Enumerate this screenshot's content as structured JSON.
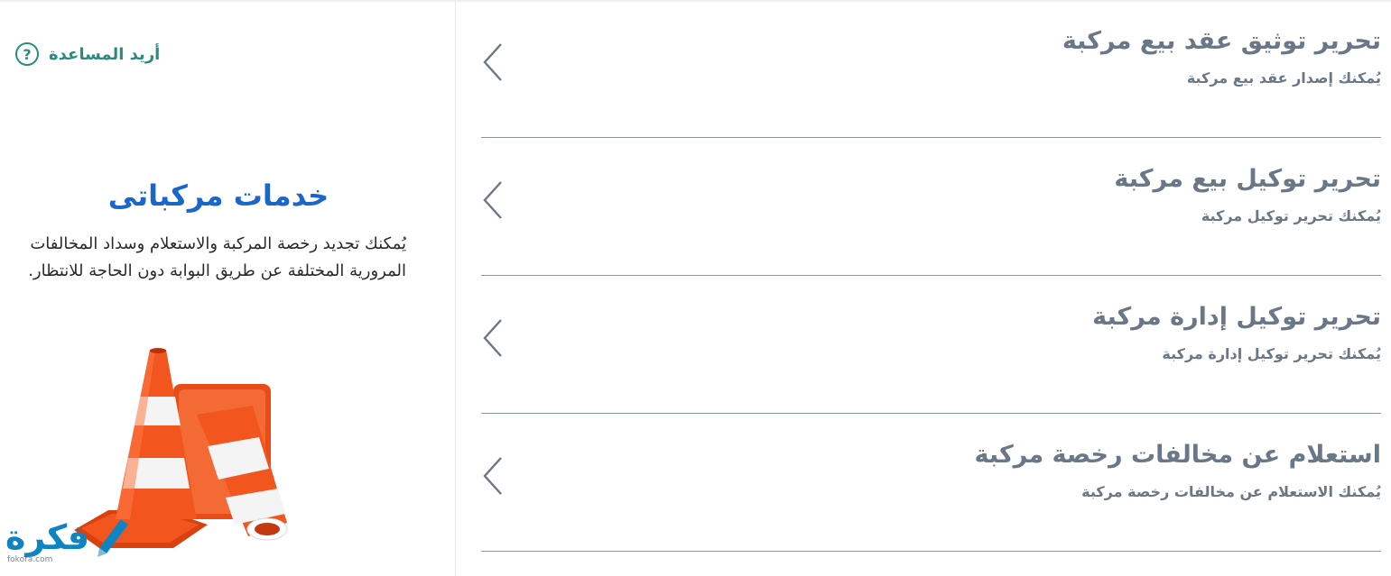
{
  "help": {
    "label": "أريد المساعدة",
    "icon": "question-circle-icon"
  },
  "panel": {
    "title": "خدمات مركباتى",
    "description": "يُمكنك تجديد رخصة المركبة والاستعلام وسداد المخالفات المرورية المختلفة عن طريق البوابة دون الحاجة للانتظار.",
    "image": "traffic-cones-illustration"
  },
  "brand": {
    "name": "فكرة",
    "domain": "fokora.com"
  },
  "services": [
    {
      "title": "تحرير توثيق عقد بيع مركبة",
      "subtitle": "يُمكنك إصدار عقد بيع مركبة",
      "icon": "chevron-left-icon"
    },
    {
      "title": "تحرير توكيل بيع مركبة",
      "subtitle": "يُمكنك تحرير توكيل مركبة",
      "icon": "chevron-left-icon"
    },
    {
      "title": "تحرير توكيل إدارة مركبة",
      "subtitle": "يُمكنك تحرير توكيل إدارة مركبة",
      "icon": "chevron-left-icon"
    },
    {
      "title": "استعلام عن مخالفات رخصة مركبة",
      "subtitle": "يُمكنك الاستعلام عن مخالفات رخصة مركبة",
      "icon": "chevron-left-icon"
    }
  ],
  "colors": {
    "accent_green": "#2a8c80",
    "title_blue": "#1b66c9",
    "text_gray": "#6a7787",
    "cone_orange": "#f2551d",
    "brand_blue": "#0f84c0"
  }
}
